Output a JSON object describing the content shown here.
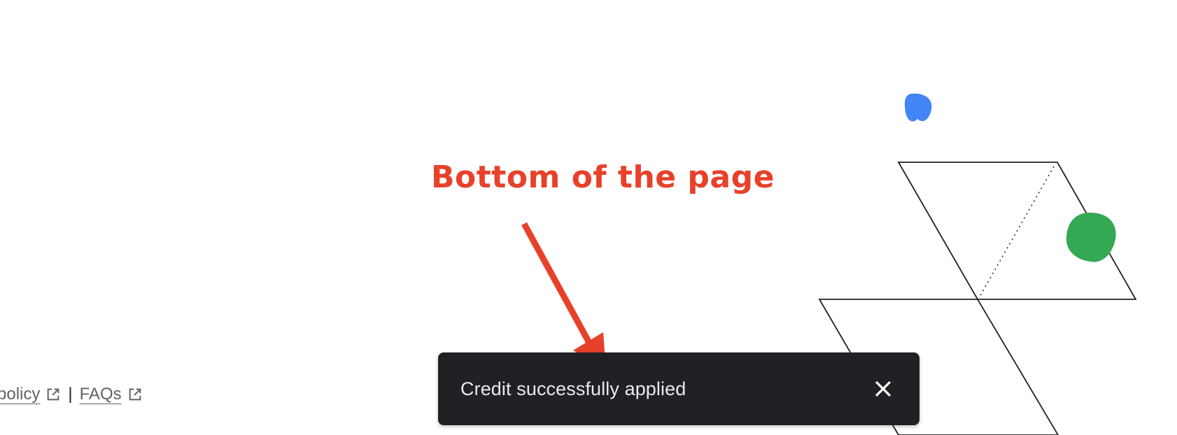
{
  "footer": {
    "policy_link": "policy",
    "separator": "|",
    "faq_link": "FAQs",
    "external_icon": "external-link-icon"
  },
  "annotation": {
    "text": "Bottom of the page",
    "color": "#e8412a",
    "arrow_icon": "arrow-annotation-icon"
  },
  "snackbar": {
    "message": "Credit successfully applied",
    "close_icon": "close-icon",
    "background": "#202124"
  },
  "decoration": {
    "blue_blob_color": "#4285f4",
    "green_blob_color": "#34a853"
  }
}
